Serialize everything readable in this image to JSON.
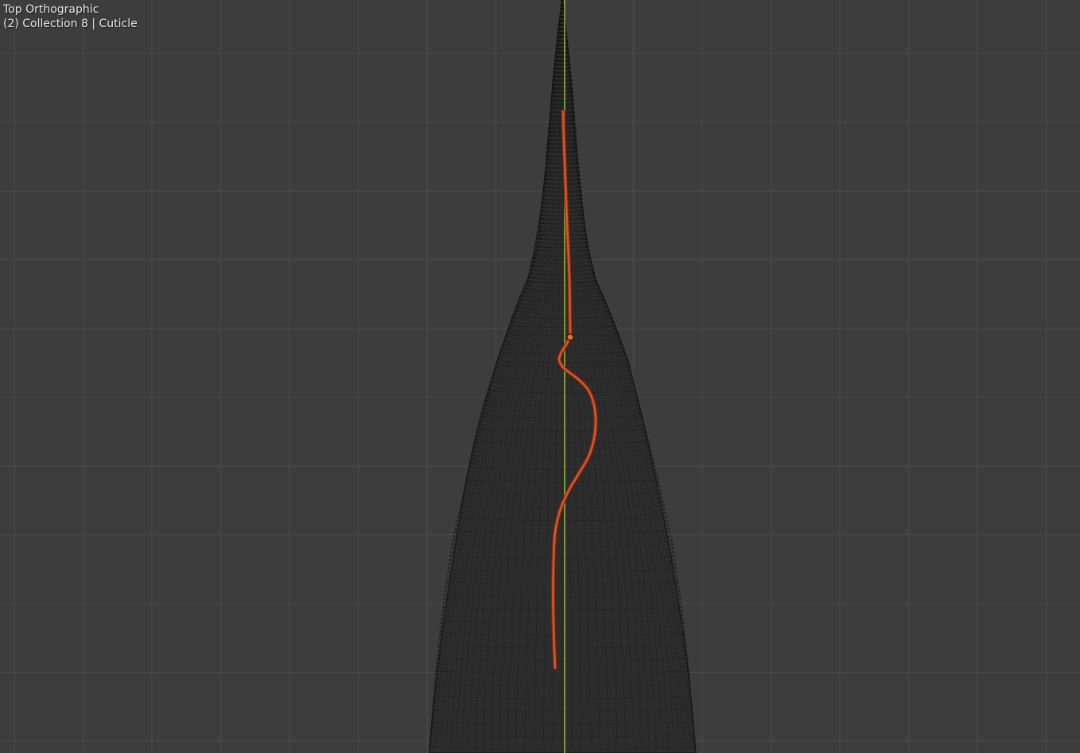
{
  "viewport": {
    "view_name": "Top Orthographic",
    "object_info": "(2) Collection 8 | Cuticle",
    "colors": {
      "background": "#3d3d3d",
      "grid_minor": "#484848",
      "grid_major": "#555555",
      "mesh_fill": "#2b2b2b",
      "mesh_wire": "#111111",
      "y_axis": "#8cb33a",
      "curve": "#d9542a",
      "curve_dark": "#8c2e14"
    }
  }
}
